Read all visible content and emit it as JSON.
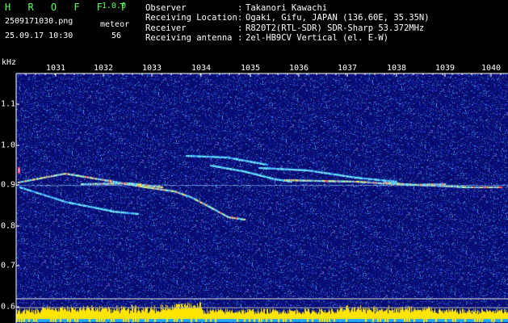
{
  "header": {
    "logo": "H R O F F T",
    "version": "1.0.0",
    "filename": "2509171030.png",
    "meteor_label": "meteor",
    "datetime": "25.09.17 10:30",
    "meteor_count": "56"
  },
  "station": {
    "observer_label": "Observer",
    "observer_value": "Takanori Kawachi",
    "location_label": "Receiving Location",
    "location_value": "Ogaki, Gifu, JAPAN (136.60E, 35.35N)",
    "receiver_label": "Receiver",
    "receiver_value": "R820T2(RTL-SDR) SDR-Sharp 53.372MHz",
    "antenna_label": "Receiving antenna",
    "antenna_value": "2el-HB9CV Vertical (el. E-W)",
    "separator": ":"
  },
  "axes": {
    "y_unit": "kHz",
    "x_ticks": [
      "1031",
      "1032",
      "1033",
      "1034",
      "1035",
      "1036",
      "1037",
      "1038",
      "1039",
      "1040"
    ],
    "y_ticks": [
      "1.1",
      "1.0",
      "0.9",
      "0.8",
      "0.7",
      "0.6"
    ]
  },
  "colors": {
    "background": "#000000",
    "noise_floor": "#0b0f6e",
    "carrier_line": "#7fc8ff",
    "meteor_trail": "#44e0ff",
    "meteor_hot": "#ff5a5a",
    "level_bars": "#ffe500",
    "logo_green": "#5cff5c"
  }
}
